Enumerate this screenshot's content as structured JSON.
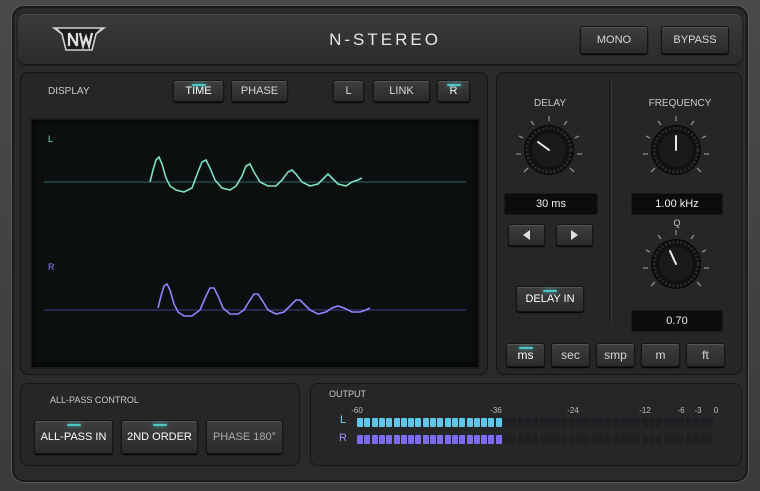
{
  "header": {
    "title": "N-STEREO",
    "mono_label": "MONO",
    "bypass_label": "BYPASS"
  },
  "display": {
    "label": "DISPLAY",
    "tabs": [
      {
        "label": "TIME",
        "active": true
      },
      {
        "label": "PHASE",
        "active": false
      }
    ],
    "channel_l_label": "L",
    "link_label": "LINK",
    "channel_r_label": "R",
    "trace_l_label": "L",
    "trace_r_label": "R",
    "trace_l_color": "#7fe0c4",
    "trace_r_color": "#8e86ff"
  },
  "delay": {
    "label": "DELAY",
    "value": "30 ms",
    "delay_in_label": "DELAY IN"
  },
  "frequency": {
    "label": "FREQUENCY",
    "value": "1.00 kHz",
    "q_label": "Q",
    "q_value": "0.70"
  },
  "units": [
    {
      "label": "ms",
      "active": true
    },
    {
      "label": "sec",
      "active": false
    },
    {
      "label": "smp",
      "active": false
    },
    {
      "label": "m",
      "active": false
    },
    {
      "label": "ft",
      "active": false
    }
  ],
  "allpass": {
    "label": "ALL-PASS CONTROL",
    "allpass_in_label": "ALL-PASS IN",
    "second_order_label": "2ND ORDER",
    "phase180_label": "PHASE 180°"
  },
  "output": {
    "label": "OUTPUT",
    "scale": [
      "-60",
      "-36",
      "-24",
      "-12",
      "-6",
      "-3",
      "0"
    ],
    "channel_l": "L",
    "channel_r": "R",
    "level_l": 0.4,
    "level_r": 0.41,
    "color_l": "#5fc8e8",
    "color_r": "#7b6cf0"
  }
}
